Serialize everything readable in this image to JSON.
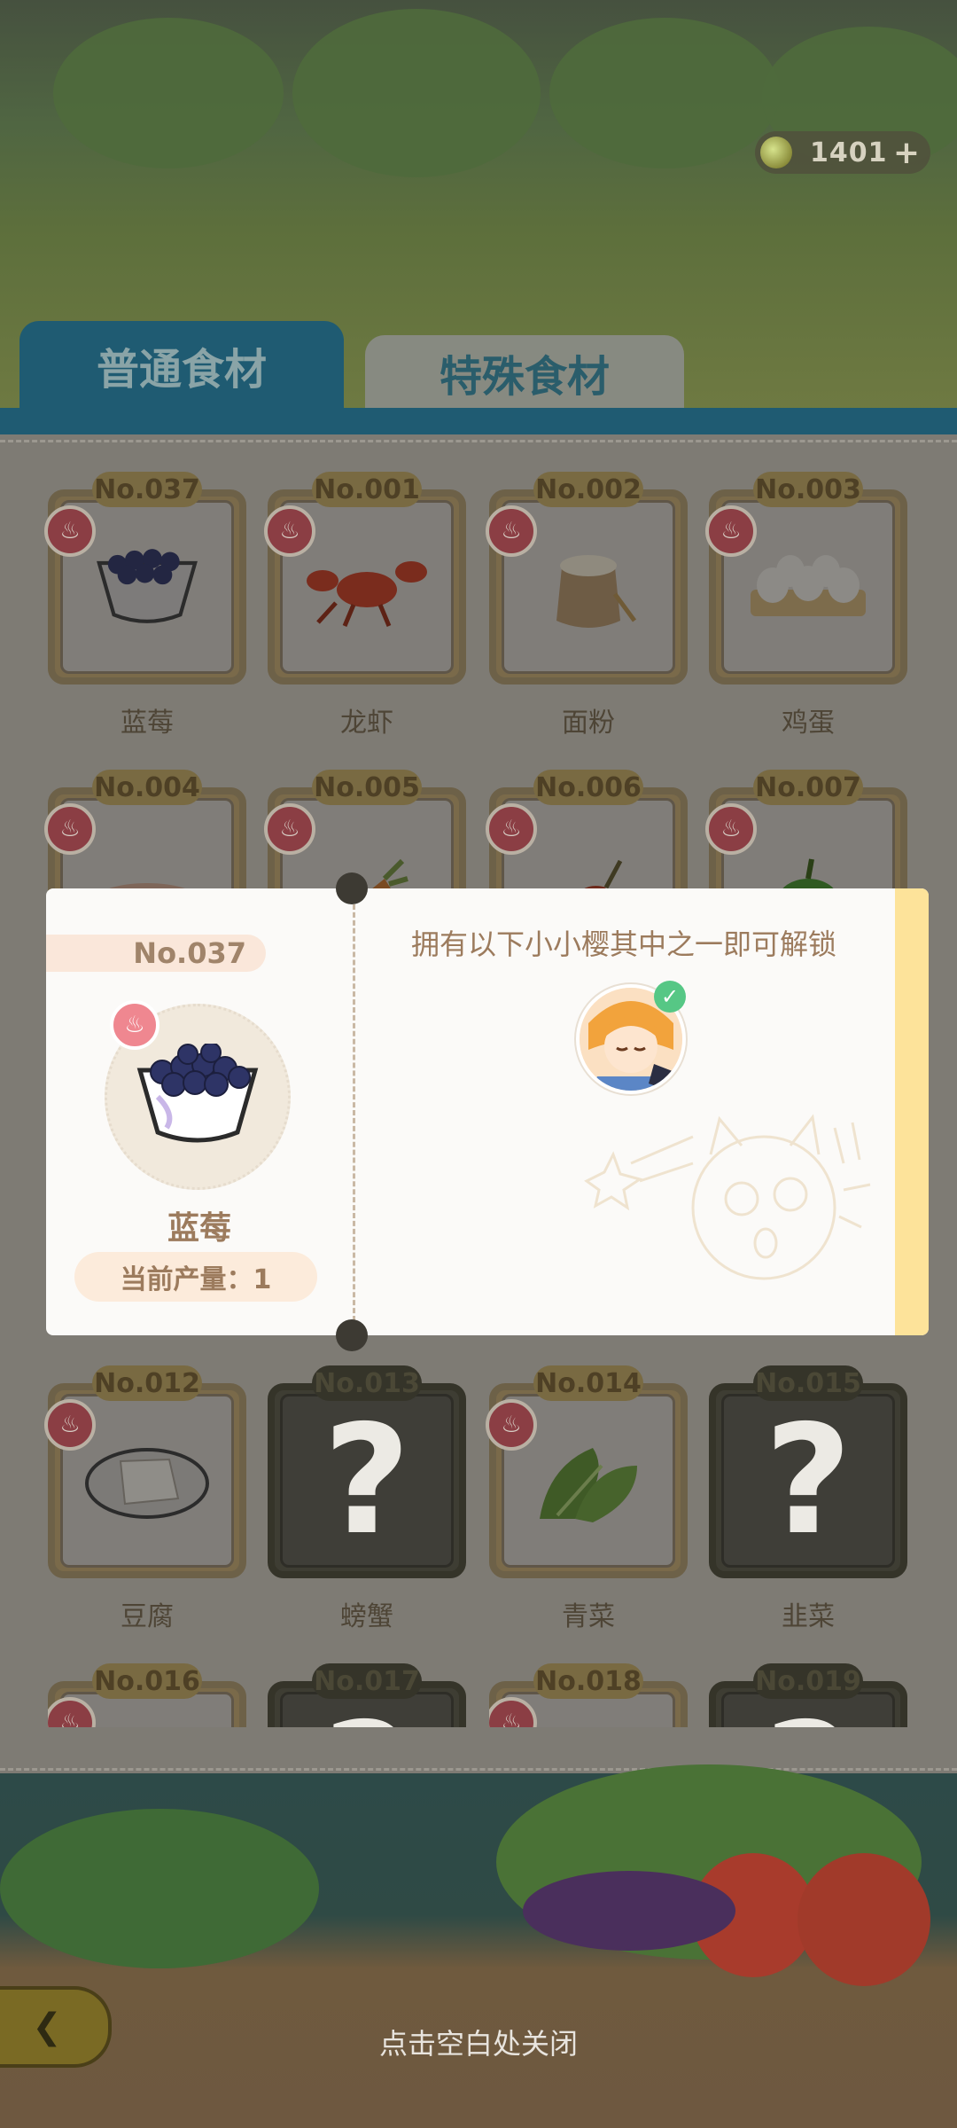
{
  "hud": {
    "currency_amount": "1401",
    "currency_plus": "+"
  },
  "tabs": {
    "normal": "普通食材",
    "special": "特殊食材"
  },
  "grid": {
    "rows": [
      [
        {
          "no": "No.037",
          "name": "蓝莓",
          "locked": false,
          "icon": "blueberry-icon"
        },
        {
          "no": "No.001",
          "name": "龙虾",
          "locked": false,
          "icon": "lobster-icon"
        },
        {
          "no": "No.002",
          "name": "面粉",
          "locked": false,
          "icon": "flour-icon"
        },
        {
          "no": "No.003",
          "name": "鸡蛋",
          "locked": false,
          "icon": "egg-icon"
        }
      ],
      [
        {
          "no": "No.004",
          "name": "",
          "locked": false,
          "icon": "shrimp-icon"
        },
        {
          "no": "No.005",
          "name": "",
          "locked": false,
          "icon": "carrot-icon"
        },
        {
          "no": "No.006",
          "name": "",
          "locked": false,
          "icon": "chili-icon"
        },
        {
          "no": "No.007",
          "name": "",
          "locked": false,
          "icon": "pepper-icon"
        }
      ],
      [
        {
          "no": "No.012",
          "name": "豆腐",
          "locked": false,
          "icon": "tofu-icon"
        },
        {
          "no": "No.013",
          "name": "螃蟹",
          "locked": true,
          "icon": "crab-icon"
        },
        {
          "no": "No.014",
          "name": "青菜",
          "locked": false,
          "icon": "bokchoy-icon"
        },
        {
          "no": "No.015",
          "name": "韭菜",
          "locked": true,
          "icon": "leek-icon"
        }
      ],
      [
        {
          "no": "No.016",
          "name": "",
          "locked": false,
          "icon": "unknown"
        },
        {
          "no": "No.017",
          "name": "",
          "locked": true,
          "icon": "unknown"
        },
        {
          "no": "No.018",
          "name": "",
          "locked": false,
          "icon": "unknown"
        },
        {
          "no": "No.019",
          "name": "",
          "locked": true,
          "icon": "unknown"
        }
      ]
    ]
  },
  "card": {
    "no": "No.037",
    "name": "蓝莓",
    "output": "当前产量：1",
    "unlock_text": "拥有以下小小樱其中之一即可解锁",
    "icon": "blueberry-icon",
    "avatar": "sakura-character-avatar",
    "avatar_owned": true
  },
  "close_hint": "点击空白处关闭",
  "colors": {
    "tab_active": "#1f5b72",
    "card_stripe": "#fde39a",
    "card_text": "#9c7b5d",
    "chef_badge": "#ef8790",
    "check_green": "#56c785"
  }
}
